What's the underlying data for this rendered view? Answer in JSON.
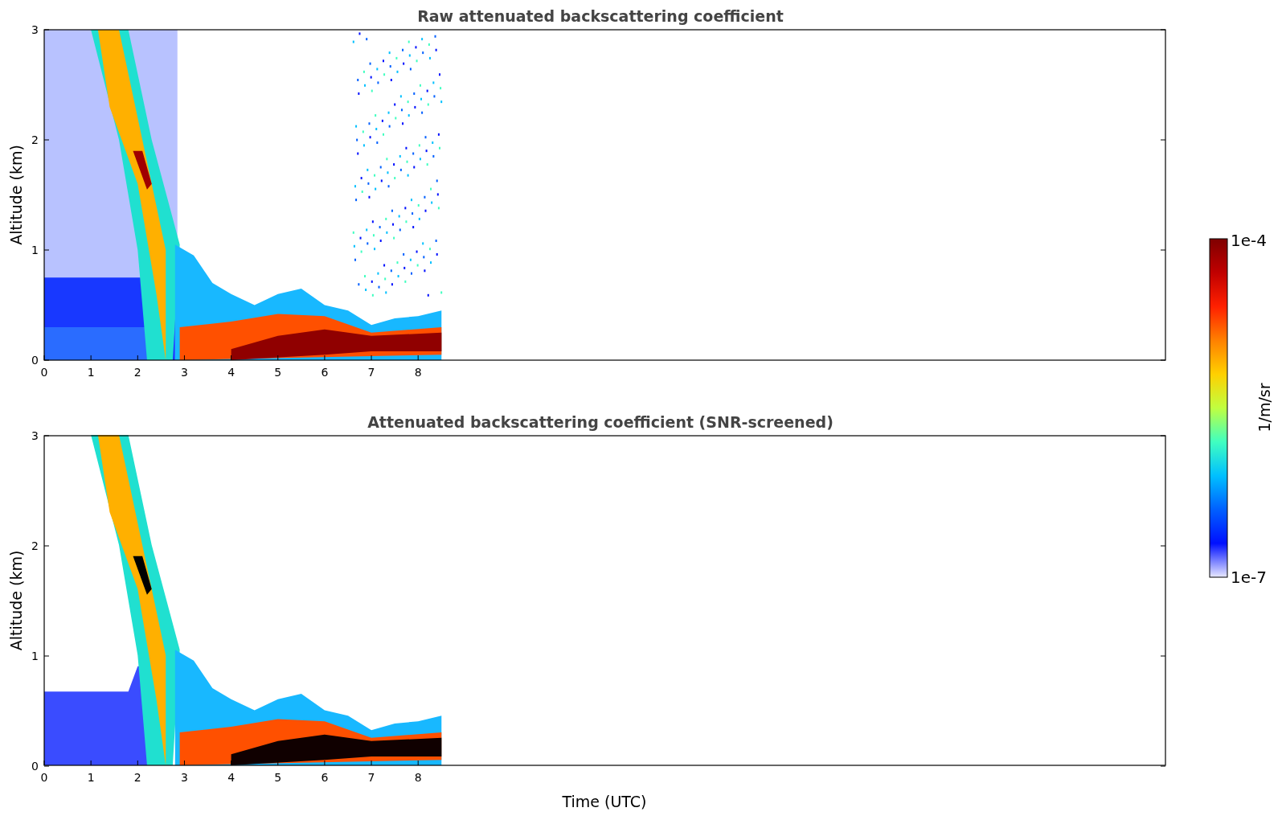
{
  "panels": [
    {
      "kind": "raw",
      "title": "Raw attenuated backscattering coefficient",
      "ylabel": "Altitude (km)",
      "yticks": [
        "3",
        "2",
        "1",
        "0"
      ],
      "xticks": [
        "0",
        "1",
        "2",
        "3",
        "4",
        "5",
        "6",
        "7",
        "8"
      ]
    },
    {
      "kind": "screened",
      "title": "Attenuated backscattering coefficient (SNR-screened)",
      "ylabel": "Altitude (km)",
      "yticks": [
        "3",
        "2",
        "1",
        "0"
      ],
      "xticks": [
        "0",
        "1",
        "2",
        "3",
        "4",
        "5",
        "6",
        "7",
        "8"
      ]
    }
  ],
  "xlabel": "Time (UTC)",
  "colorbar": {
    "label": "1/m/sr",
    "max": "1e-4",
    "min": "1e-7"
  }
}
